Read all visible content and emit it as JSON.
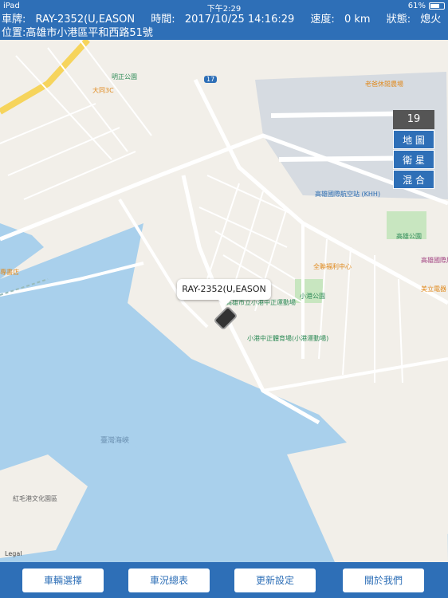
{
  "status_bar": {
    "device": "iPad",
    "time": "下午2:29",
    "battery": "61%"
  },
  "vehicle_info": {
    "plate_label": "車牌:",
    "plate_value": "RAY-2352(U,EASON",
    "time_label": "時間:",
    "time_value": "2017/10/25 14:16:29",
    "speed_label": "速度:",
    "speed_value": "0 km",
    "state_label": "狀態:",
    "state_value": "熄火",
    "location_label": "位置:",
    "location_value": "高雄市小港區平和西路51號"
  },
  "map": {
    "popup_text": "RAY-2352(U,EASON",
    "zoom_level": "19",
    "controls": [
      "地 圖",
      "衛 星",
      "混 合"
    ],
    "legal": "Legal",
    "labels": {
      "strait": "臺灣海峽",
      "airport": "高雄國際航空站 (KHH)",
      "park_nearby": "小港公園",
      "stadium": "高雄市立小港中正運動場",
      "sports": "小港中正體育場(小港運動場)",
      "culture_park": "紅毛港文化園區",
      "welfare": "全聯福利中心",
      "mingzheng": "明正公園",
      "datong": "大同3C",
      "kaohsiung_park": "高雄公園",
      "convention": "高雄國際展",
      "hotel": "美立電器",
      "leisure": "老爸休閒農場",
      "bookstore": "專書店",
      "route17": "17"
    }
  },
  "bottom_tabs": [
    "車輛選擇",
    "車況總表",
    "更新設定",
    "關於我們"
  ],
  "colors": {
    "header_bg": "#2e6fb7",
    "water": "#a9d0ec",
    "land": "#f2efe9",
    "road": "#ffffff",
    "highway": "#f6d45c"
  }
}
